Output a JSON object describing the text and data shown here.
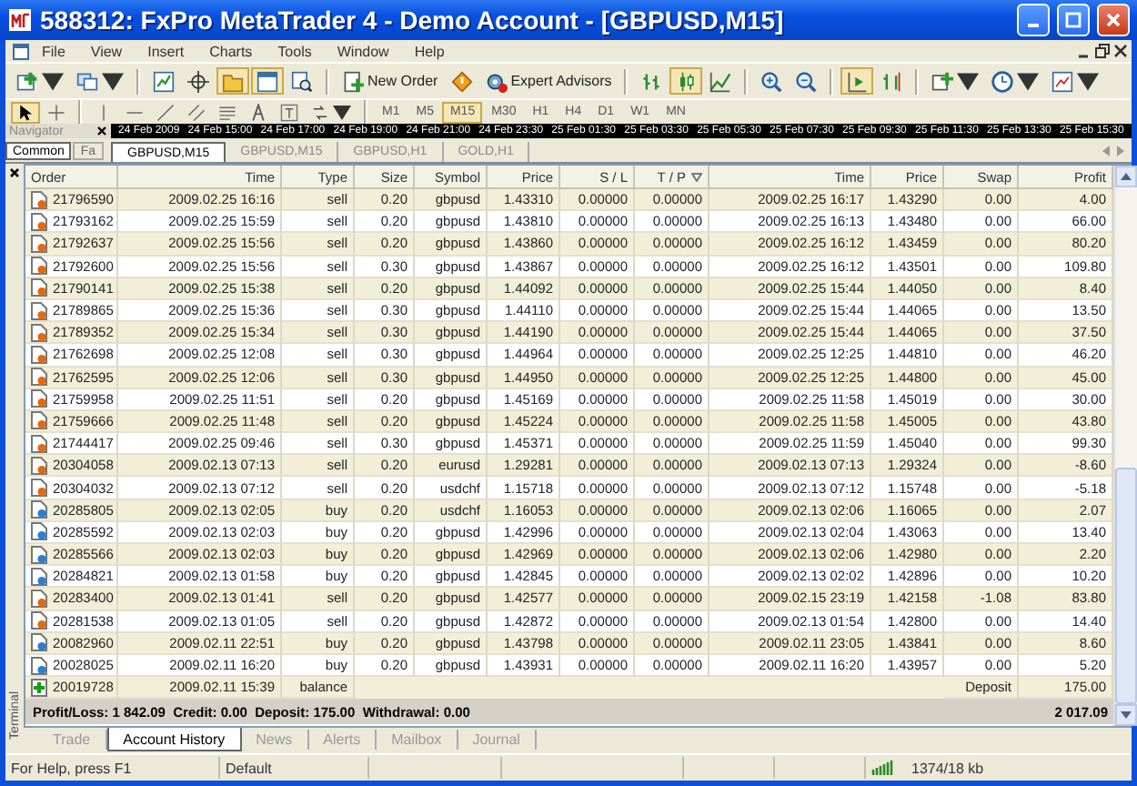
{
  "window": {
    "title": "588312: FxPro MetaTrader 4 - Demo Account - [GBPUSD,M15]"
  },
  "menu": [
    "File",
    "View",
    "Insert",
    "Charts",
    "Tools",
    "Window",
    "Help"
  ],
  "toolbar": [
    {
      "kind": "new-chart",
      "pressed": false
    },
    {
      "kind": "profiles",
      "pressed": false
    },
    {
      "kind": "separator"
    },
    {
      "kind": "market-watch",
      "pressed": false
    },
    {
      "kind": "data-window",
      "pressed": false
    },
    {
      "kind": "navigator",
      "pressed": true
    },
    {
      "kind": "terminal",
      "pressed": true
    },
    {
      "kind": "tester",
      "pressed": false
    },
    {
      "kind": "separator"
    },
    {
      "kind": "new-order",
      "label": "New Order",
      "pressed": false
    },
    {
      "kind": "alert",
      "pressed": false
    },
    {
      "kind": "experts",
      "label": "Expert Advisors",
      "pressed": false
    },
    {
      "kind": "separator"
    },
    {
      "kind": "bars",
      "pressed": false
    },
    {
      "kind": "candles",
      "pressed": true
    },
    {
      "kind": "line",
      "pressed": false
    },
    {
      "kind": "separator"
    },
    {
      "kind": "zoom-in",
      "pressed": false
    },
    {
      "kind": "zoom-out",
      "pressed": false
    },
    {
      "kind": "separator"
    },
    {
      "kind": "autoscroll",
      "pressed": true
    },
    {
      "kind": "shift",
      "pressed": false
    },
    {
      "kind": "separator"
    },
    {
      "kind": "indicators",
      "pressed": false
    },
    {
      "kind": "periods",
      "pressed": false
    },
    {
      "kind": "templates",
      "pressed": false
    }
  ],
  "drawing_tools": [
    {
      "kind": "cursor",
      "pressed": true
    },
    {
      "kind": "crosshair",
      "pressed": false
    },
    {
      "kind": "separator"
    },
    {
      "kind": "vline",
      "pressed": false
    },
    {
      "kind": "hline",
      "pressed": false
    },
    {
      "kind": "trend",
      "pressed": false
    },
    {
      "kind": "channel",
      "pressed": false
    },
    {
      "kind": "fibo",
      "pressed": false
    },
    {
      "kind": "text",
      "pressed": false
    },
    {
      "kind": "label",
      "pressed": false
    },
    {
      "kind": "arrows",
      "pressed": false
    },
    {
      "kind": "separator"
    }
  ],
  "timeframes": [
    {
      "label": "M1",
      "selected": false
    },
    {
      "label": "M5",
      "selected": false
    },
    {
      "label": "M15",
      "selected": true
    },
    {
      "label": "M30",
      "selected": false
    },
    {
      "label": "H1",
      "selected": false
    },
    {
      "label": "H4",
      "selected": false
    },
    {
      "label": "D1",
      "selected": false
    },
    {
      "label": "W1",
      "selected": false
    },
    {
      "label": "MN",
      "selected": false
    }
  ],
  "navigator": {
    "title": "Navigator",
    "tabs": [
      {
        "label": "Common",
        "selected": true
      },
      {
        "label": "Fa",
        "selected": false
      }
    ]
  },
  "time_axis": [
    "24 Feb 2009",
    "24 Feb 15:00",
    "24 Feb 17:00",
    "24 Feb 19:00",
    "24 Feb 21:00",
    "24 Feb 23:30",
    "25 Feb 01:30",
    "25 Feb 03:30",
    "25 Feb 05:30",
    "25 Feb 07:30",
    "25 Feb 09:30",
    "25 Feb 11:30",
    "25 Feb 13:30",
    "25 Feb 15:30"
  ],
  "chart_tabs": [
    {
      "label": "GBPUSD,M15",
      "selected": true
    },
    {
      "label": "GBPUSD,M15",
      "selected": false
    },
    {
      "label": "GBPUSD,H1",
      "selected": false
    },
    {
      "label": "GOLD,H1",
      "selected": false
    }
  ],
  "terminal": {
    "title": "Terminal",
    "columns": [
      {
        "label": "Order",
        "sorted": false
      },
      {
        "label": "Time",
        "sorted": false
      },
      {
        "label": "Type",
        "sorted": false
      },
      {
        "label": "Size",
        "sorted": false
      },
      {
        "label": "Symbol",
        "sorted": false
      },
      {
        "label": "Price",
        "sorted": false
      },
      {
        "label": "S / L",
        "sorted": false
      },
      {
        "label": "T / P",
        "sorted": true
      },
      {
        "label": "Time",
        "sorted": false
      },
      {
        "label": "Price",
        "sorted": false
      },
      {
        "label": "Swap",
        "sorted": false
      },
      {
        "label": "Profit",
        "sorted": false
      }
    ],
    "rows": [
      {
        "kind": "sell",
        "order": "21796590",
        "time": "2009.02.25 16:16",
        "type": "sell",
        "size": "0.20",
        "symbol": "gbpusd",
        "price": "1.43310",
        "sl": "0.00000",
        "tp": "0.00000",
        "close_time": "2009.02.25 16:17",
        "close_price": "1.43290",
        "swap": "0.00",
        "profit": "4.00"
      },
      {
        "kind": "sell",
        "order": "21793162",
        "time": "2009.02.25 15:59",
        "type": "sell",
        "size": "0.20",
        "symbol": "gbpusd",
        "price": "1.43810",
        "sl": "0.00000",
        "tp": "0.00000",
        "close_time": "2009.02.25 16:13",
        "close_price": "1.43480",
        "swap": "0.00",
        "profit": "66.00"
      },
      {
        "kind": "sell",
        "order": "21792637",
        "time": "2009.02.25 15:56",
        "type": "sell",
        "size": "0.20",
        "symbol": "gbpusd",
        "price": "1.43860",
        "sl": "0.00000",
        "tp": "0.00000",
        "close_time": "2009.02.25 16:12",
        "close_price": "1.43459",
        "swap": "0.00",
        "profit": "80.20"
      },
      {
        "kind": "sell",
        "order": "21792600",
        "time": "2009.02.25 15:56",
        "type": "sell",
        "size": "0.30",
        "symbol": "gbpusd",
        "price": "1.43867",
        "sl": "0.00000",
        "tp": "0.00000",
        "close_time": "2009.02.25 16:12",
        "close_price": "1.43501",
        "swap": "0.00",
        "profit": "109.80"
      },
      {
        "kind": "sell",
        "order": "21790141",
        "time": "2009.02.25 15:38",
        "type": "sell",
        "size": "0.20",
        "symbol": "gbpusd",
        "price": "1.44092",
        "sl": "0.00000",
        "tp": "0.00000",
        "close_time": "2009.02.25 15:44",
        "close_price": "1.44050",
        "swap": "0.00",
        "profit": "8.40"
      },
      {
        "kind": "sell",
        "order": "21789865",
        "time": "2009.02.25 15:36",
        "type": "sell",
        "size": "0.30",
        "symbol": "gbpusd",
        "price": "1.44110",
        "sl": "0.00000",
        "tp": "0.00000",
        "close_time": "2009.02.25 15:44",
        "close_price": "1.44065",
        "swap": "0.00",
        "profit": "13.50"
      },
      {
        "kind": "sell",
        "order": "21789352",
        "time": "2009.02.25 15:34",
        "type": "sell",
        "size": "0.30",
        "symbol": "gbpusd",
        "price": "1.44190",
        "sl": "0.00000",
        "tp": "0.00000",
        "close_time": "2009.02.25 15:44",
        "close_price": "1.44065",
        "swap": "0.00",
        "profit": "37.50"
      },
      {
        "kind": "sell",
        "order": "21762698",
        "time": "2009.02.25 12:08",
        "type": "sell",
        "size": "0.30",
        "symbol": "gbpusd",
        "price": "1.44964",
        "sl": "0.00000",
        "tp": "0.00000",
        "close_time": "2009.02.25 12:25",
        "close_price": "1.44810",
        "swap": "0.00",
        "profit": "46.20"
      },
      {
        "kind": "sell",
        "order": "21762595",
        "time": "2009.02.25 12:06",
        "type": "sell",
        "size": "0.30",
        "symbol": "gbpusd",
        "price": "1.44950",
        "sl": "0.00000",
        "tp": "0.00000",
        "close_time": "2009.02.25 12:25",
        "close_price": "1.44800",
        "swap": "0.00",
        "profit": "45.00"
      },
      {
        "kind": "sell",
        "order": "21759958",
        "time": "2009.02.25 11:51",
        "type": "sell",
        "size": "0.20",
        "symbol": "gbpusd",
        "price": "1.45169",
        "sl": "0.00000",
        "tp": "0.00000",
        "close_time": "2009.02.25 11:58",
        "close_price": "1.45019",
        "swap": "0.00",
        "profit": "30.00"
      },
      {
        "kind": "sell",
        "order": "21759666",
        "time": "2009.02.25 11:48",
        "type": "sell",
        "size": "0.20",
        "symbol": "gbpusd",
        "price": "1.45224",
        "sl": "0.00000",
        "tp": "0.00000",
        "close_time": "2009.02.25 11:58",
        "close_price": "1.45005",
        "swap": "0.00",
        "profit": "43.80"
      },
      {
        "kind": "sell",
        "order": "21744417",
        "time": "2009.02.25 09:46",
        "type": "sell",
        "size": "0.30",
        "symbol": "gbpusd",
        "price": "1.45371",
        "sl": "0.00000",
        "tp": "0.00000",
        "close_time": "2009.02.25 11:59",
        "close_price": "1.45040",
        "swap": "0.00",
        "profit": "99.30"
      },
      {
        "kind": "sell",
        "order": "20304058",
        "time": "2009.02.13 07:13",
        "type": "sell",
        "size": "0.20",
        "symbol": "eurusd",
        "price": "1.29281",
        "sl": "0.00000",
        "tp": "0.00000",
        "close_time": "2009.02.13 07:13",
        "close_price": "1.29324",
        "swap": "0.00",
        "profit": "-8.60"
      },
      {
        "kind": "sell",
        "order": "20304032",
        "time": "2009.02.13 07:12",
        "type": "sell",
        "size": "0.20",
        "symbol": "usdchf",
        "price": "1.15718",
        "sl": "0.00000",
        "tp": "0.00000",
        "close_time": "2009.02.13 07:12",
        "close_price": "1.15748",
        "swap": "0.00",
        "profit": "-5.18"
      },
      {
        "kind": "buy",
        "order": "20285805",
        "time": "2009.02.13 02:05",
        "type": "buy",
        "size": "0.20",
        "symbol": "usdchf",
        "price": "1.16053",
        "sl": "0.00000",
        "tp": "0.00000",
        "close_time": "2009.02.13 02:06",
        "close_price": "1.16065",
        "swap": "0.00",
        "profit": "2.07"
      },
      {
        "kind": "buy",
        "order": "20285592",
        "time": "2009.02.13 02:03",
        "type": "buy",
        "size": "0.20",
        "symbol": "gbpusd",
        "price": "1.42996",
        "sl": "0.00000",
        "tp": "0.00000",
        "close_time": "2009.02.13 02:04",
        "close_price": "1.43063",
        "swap": "0.00",
        "profit": "13.40"
      },
      {
        "kind": "buy",
        "order": "20285566",
        "time": "2009.02.13 02:03",
        "type": "buy",
        "size": "0.20",
        "symbol": "gbpusd",
        "price": "1.42969",
        "sl": "0.00000",
        "tp": "0.00000",
        "close_time": "2009.02.13 02:06",
        "close_price": "1.42980",
        "swap": "0.00",
        "profit": "2.20"
      },
      {
        "kind": "buy",
        "order": "20284821",
        "time": "2009.02.13 01:58",
        "type": "buy",
        "size": "0.20",
        "symbol": "gbpusd",
        "price": "1.42845",
        "sl": "0.00000",
        "tp": "0.00000",
        "close_time": "2009.02.13 02:02",
        "close_price": "1.42896",
        "swap": "0.00",
        "profit": "10.20"
      },
      {
        "kind": "sell",
        "order": "20283400",
        "time": "2009.02.13 01:41",
        "type": "sell",
        "size": "0.20",
        "symbol": "gbpusd",
        "price": "1.42577",
        "sl": "0.00000",
        "tp": "0.00000",
        "close_time": "2009.02.15 23:19",
        "close_price": "1.42158",
        "swap": "-1.08",
        "profit": "83.80"
      },
      {
        "kind": "sell",
        "order": "20281538",
        "time": "2009.02.13 01:05",
        "type": "sell",
        "size": "0.20",
        "symbol": "gbpusd",
        "price": "1.42872",
        "sl": "0.00000",
        "tp": "0.00000",
        "close_time": "2009.02.13 01:54",
        "close_price": "1.42800",
        "swap": "0.00",
        "profit": "14.40"
      },
      {
        "kind": "buy",
        "order": "20082960",
        "time": "2009.02.11 22:51",
        "type": "buy",
        "size": "0.20",
        "symbol": "gbpusd",
        "price": "1.43798",
        "sl": "0.00000",
        "tp": "0.00000",
        "close_time": "2009.02.11 23:05",
        "close_price": "1.43841",
        "swap": "0.00",
        "profit": "8.60"
      },
      {
        "kind": "buy",
        "order": "20028025",
        "time": "2009.02.11 16:20",
        "type": "buy",
        "size": "0.20",
        "symbol": "gbpusd",
        "price": "1.43931",
        "sl": "0.00000",
        "tp": "0.00000",
        "close_time": "2009.02.11 16:20",
        "close_price": "1.43957",
        "swap": "0.00",
        "profit": "5.20"
      },
      {
        "kind": "balance",
        "order": "20019728",
        "time": "2009.02.11 15:39",
        "type": "balance",
        "swap": "Deposit",
        "profit": "175.00"
      }
    ],
    "summary": {
      "text": "Profit/Loss: 1 842.09  Credit: 0.00  Deposit: 175.00  Withdrawal: 0.00",
      "total": "2 017.09"
    },
    "tabs": [
      {
        "label": "Trade",
        "selected": false
      },
      {
        "label": "Account History",
        "selected": true
      },
      {
        "label": "News",
        "selected": false
      },
      {
        "label": "Alerts",
        "selected": false
      },
      {
        "label": "Mailbox",
        "selected": false
      },
      {
        "label": "Journal",
        "selected": false
      }
    ]
  },
  "status_bar": {
    "help": "For Help, press F1",
    "profile": "Default",
    "traffic": "1374/18 kb"
  }
}
